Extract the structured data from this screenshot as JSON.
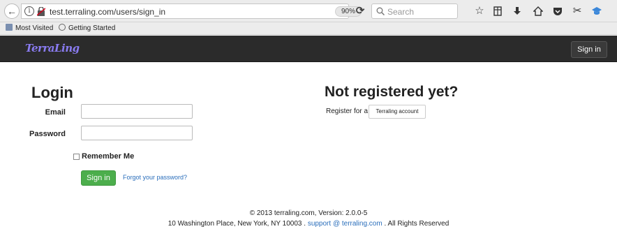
{
  "browser": {
    "url": "test.terraling.com/users/sign_in",
    "zoom": "90%",
    "search_placeholder": "Search",
    "bookmarks": [
      "Most Visited",
      "Getting Started"
    ]
  },
  "nav": {
    "brand": "TerraLing",
    "signin_label": "Sign in"
  },
  "login": {
    "title": "Login",
    "email_label": "Email",
    "email_value": "",
    "password_label": "Password",
    "password_value": "",
    "remember_label": "Remember Me",
    "remember_checked": false,
    "signin_label": "Sign in",
    "forgot_label": "Forgot your password?"
  },
  "register": {
    "title": "Not registered yet?",
    "prompt": "Register for a",
    "button_label": "Terraling account"
  },
  "footer": {
    "line1": "© 2013 terraling.com, Version: 2.0.0-5",
    "address": "10 Washington Place, New York, NY 10003 .",
    "support_link": "support @ terraling.com",
    "rights": ". All Rights Reserved"
  },
  "colors": {
    "accent_green": "#4cae4c",
    "brand_purple": "#8a7cf2",
    "nav_bg": "#2b2b2b",
    "link_blue": "#2a6ebb"
  }
}
